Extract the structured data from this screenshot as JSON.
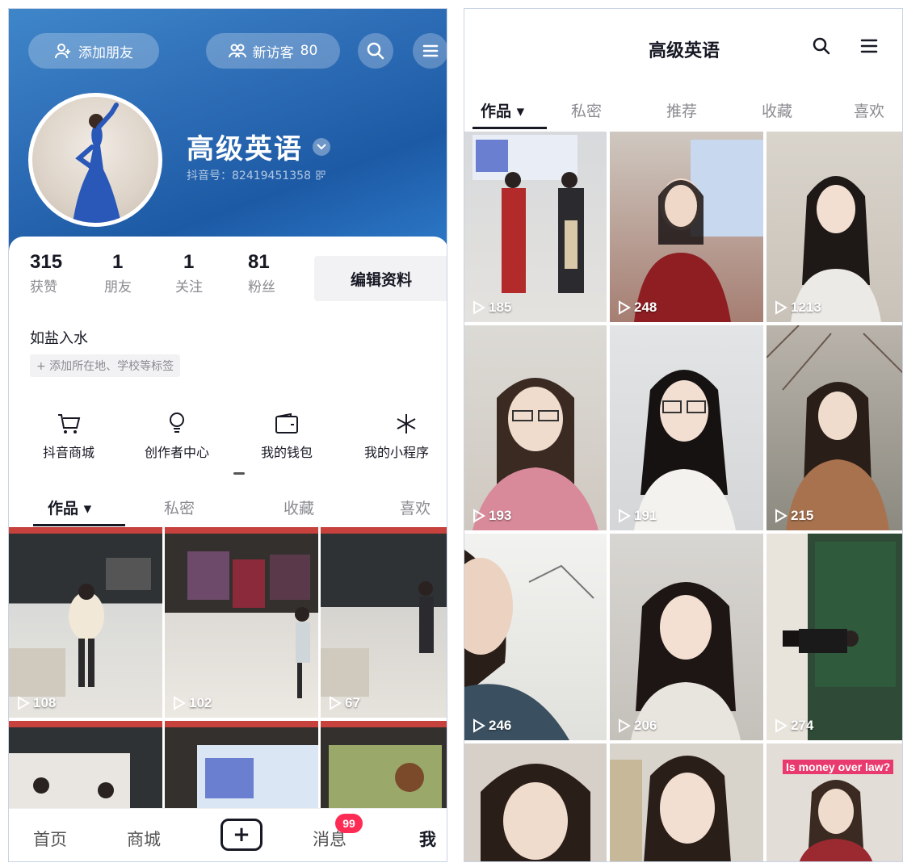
{
  "left": {
    "add_friend_label": "添加朋友",
    "new_visitors_label": "新访客",
    "new_visitors_count": "80",
    "profile_name": "高级英语",
    "douyin_id": "抖音号：82419451358",
    "stats": [
      {
        "value": "315",
        "label": "获赞"
      },
      {
        "value": "1",
        "label": "朋友"
      },
      {
        "value": "1",
        "label": "关注"
      },
      {
        "value": "81",
        "label": "粉丝"
      }
    ],
    "edit_profile_label": "编辑资料",
    "bio": "如盐入水",
    "add_tag_label": "+ 添加所在地、学校等标签",
    "shortcuts": [
      {
        "label": "抖音商城",
        "icon": "cart-icon"
      },
      {
        "label": "创作者中心",
        "icon": "bulb-icon"
      },
      {
        "label": "我的钱包",
        "icon": "wallet-icon"
      },
      {
        "label": "我的小程序",
        "icon": "spark-icon"
      }
    ],
    "tabs": [
      "作品 ▾",
      "私密",
      "收藏",
      "喜欢"
    ],
    "videos": [
      {
        "plays": "108"
      },
      {
        "plays": "102"
      },
      {
        "plays": "67"
      }
    ],
    "bottom_nav": {
      "home": "首页",
      "mall": "商城",
      "create": "+",
      "messages": "消息",
      "messages_badge": "99",
      "me": "我"
    }
  },
  "right": {
    "title": "高级英语",
    "tabs": [
      "作品 ▾",
      "私密",
      "推荐",
      "收藏",
      "喜欢"
    ],
    "videos": [
      {
        "plays": "185"
      },
      {
        "plays": "248"
      },
      {
        "plays": "1213"
      },
      {
        "plays": "193"
      },
      {
        "plays": "191"
      },
      {
        "plays": "215"
      },
      {
        "plays": "246"
      },
      {
        "plays": "206"
      },
      {
        "plays": "274"
      }
    ],
    "last_row_caption": "Is money over law?"
  },
  "colors": {
    "hero_blue": "#2f6fb8",
    "badge_red": "#fe2c55",
    "text_dark": "#161823",
    "text_grey": "#8a8b91"
  }
}
